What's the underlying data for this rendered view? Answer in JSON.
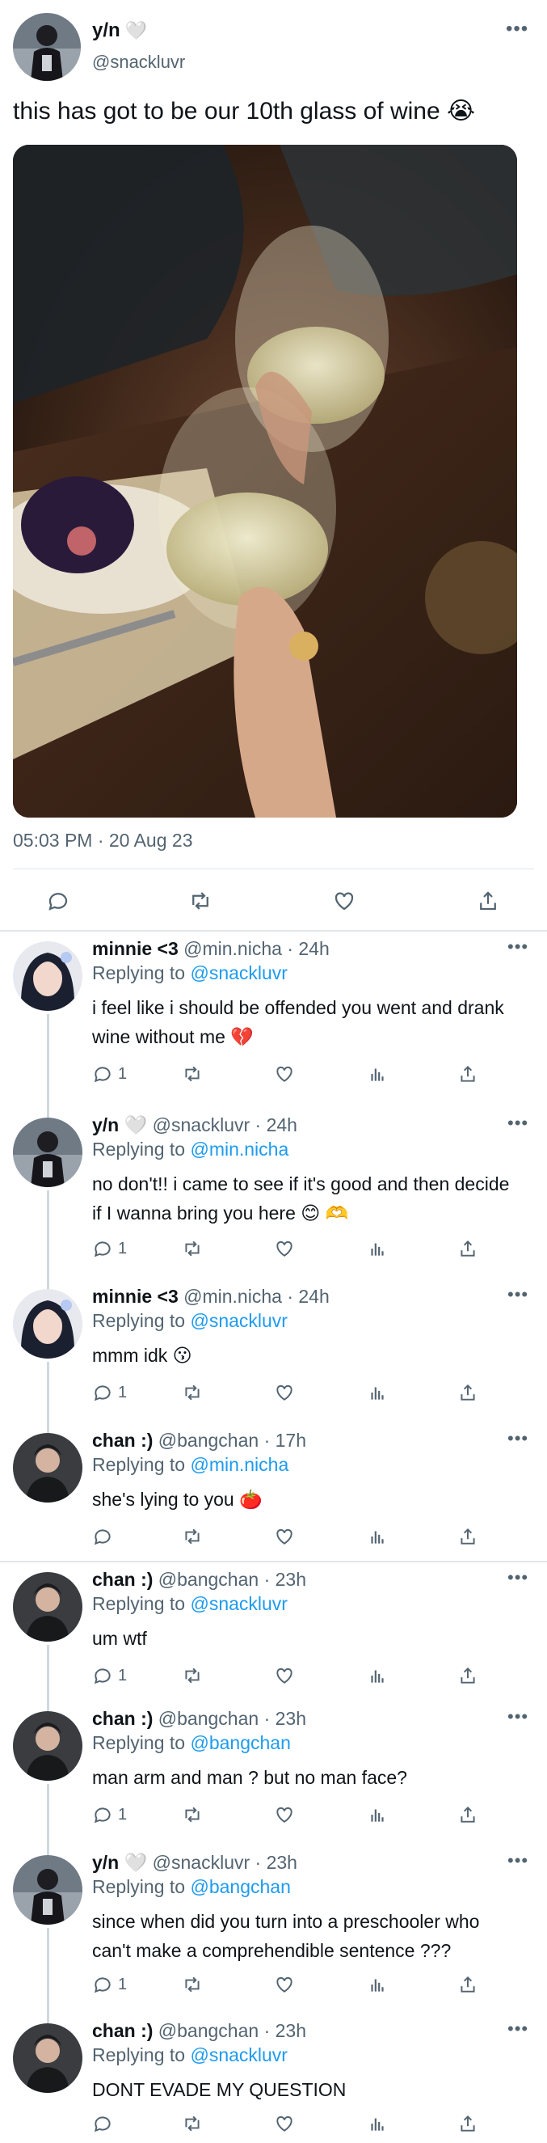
{
  "main_tweet": {
    "display_name": "y/n",
    "heart_emoji": "🤍",
    "handle": "@snackluvr",
    "more_label": "•••",
    "text": "this has got to be our 10th glass of wine 😭",
    "timestamp": "05:03 PM · 20 Aug 23",
    "actions": [
      "reply-icon",
      "retweet-icon",
      "like-icon",
      "share-icon"
    ]
  },
  "replies": [
    {
      "display_name": "minnie <3",
      "heart": "",
      "handle": "@min.nicha",
      "time": "· 24h",
      "replying_prefix": "Replying to ",
      "replying_to": "@snackluvr",
      "text": "i feel like i should be offended you went and drank wine without me 💔",
      "reply_count": "1",
      "avatar": "minnie"
    },
    {
      "display_name": "y/n",
      "heart": "🤍",
      "handle": "@snackluvr",
      "time": "· 24h",
      "replying_prefix": "Replying to ",
      "replying_to": "@min.nicha",
      "text": "no don't!! i came to see if it's good and then decide if I wanna bring you here 😊 🫶",
      "reply_count": "1",
      "avatar": "yn"
    },
    {
      "display_name": "minnie <3",
      "heart": "",
      "handle": "@min.nicha",
      "time": "· 24h",
      "replying_prefix": "Replying to ",
      "replying_to": "@snackluvr",
      "text": "mmm idk 😗",
      "reply_count": "1",
      "avatar": "minnie"
    },
    {
      "display_name": "chan :)",
      "heart": "",
      "handle": "@bangchan",
      "time": "· 17h",
      "replying_prefix": "Replying to ",
      "replying_to": "@min.nicha",
      "text": "she's lying to you 🍅",
      "reply_count": "",
      "avatar": "chan"
    },
    {
      "display_name": "chan :)",
      "heart": "",
      "handle": "@bangchan",
      "time": "· 23h",
      "replying_prefix": "Replying to ",
      "replying_to": "@snackluvr",
      "text": "um wtf",
      "reply_count": "1",
      "avatar": "chan"
    },
    {
      "display_name": "chan :)",
      "heart": "",
      "handle": "@bangchan",
      "time": "· 23h",
      "replying_prefix": "Replying to ",
      "replying_to": "@bangchan",
      "text": "man arm and man ? but no man face?",
      "reply_count": "1",
      "avatar": "chan"
    },
    {
      "display_name": "y/n",
      "heart": "🤍",
      "handle": "@snackluvr",
      "time": "· 23h",
      "replying_prefix": "Replying to ",
      "replying_to": "@bangchan",
      "text": "since when did you turn into a preschooler who can't make a comprehendible sentence ???",
      "reply_count": "1",
      "avatar": "yn"
    },
    {
      "display_name": "chan :)",
      "heart": "",
      "handle": "@bangchan",
      "time": "· 23h",
      "replying_prefix": "Replying to ",
      "replying_to": "@snackluvr",
      "text": "DONT EVADE MY QUESTION",
      "reply_count": "",
      "avatar": "chan"
    }
  ],
  "colors": {
    "link": "#1d9bf0",
    "secondary_text": "#536471",
    "divider": "#e1e6ea"
  }
}
